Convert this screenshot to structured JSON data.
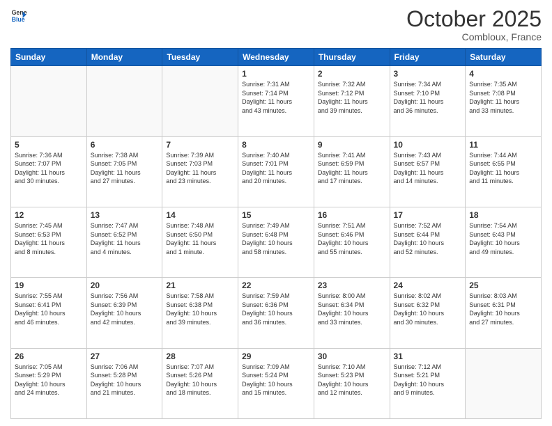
{
  "header": {
    "logo_line1": "General",
    "logo_line2": "Blue",
    "month": "October 2025",
    "location": "Combloux, France"
  },
  "days_of_week": [
    "Sunday",
    "Monday",
    "Tuesday",
    "Wednesday",
    "Thursday",
    "Friday",
    "Saturday"
  ],
  "weeks": [
    [
      {
        "day": "",
        "info": ""
      },
      {
        "day": "",
        "info": ""
      },
      {
        "day": "",
        "info": ""
      },
      {
        "day": "1",
        "info": "Sunrise: 7:31 AM\nSunset: 7:14 PM\nDaylight: 11 hours\nand 43 minutes."
      },
      {
        "day": "2",
        "info": "Sunrise: 7:32 AM\nSunset: 7:12 PM\nDaylight: 11 hours\nand 39 minutes."
      },
      {
        "day": "3",
        "info": "Sunrise: 7:34 AM\nSunset: 7:10 PM\nDaylight: 11 hours\nand 36 minutes."
      },
      {
        "day": "4",
        "info": "Sunrise: 7:35 AM\nSunset: 7:08 PM\nDaylight: 11 hours\nand 33 minutes."
      }
    ],
    [
      {
        "day": "5",
        "info": "Sunrise: 7:36 AM\nSunset: 7:07 PM\nDaylight: 11 hours\nand 30 minutes."
      },
      {
        "day": "6",
        "info": "Sunrise: 7:38 AM\nSunset: 7:05 PM\nDaylight: 11 hours\nand 27 minutes."
      },
      {
        "day": "7",
        "info": "Sunrise: 7:39 AM\nSunset: 7:03 PM\nDaylight: 11 hours\nand 23 minutes."
      },
      {
        "day": "8",
        "info": "Sunrise: 7:40 AM\nSunset: 7:01 PM\nDaylight: 11 hours\nand 20 minutes."
      },
      {
        "day": "9",
        "info": "Sunrise: 7:41 AM\nSunset: 6:59 PM\nDaylight: 11 hours\nand 17 minutes."
      },
      {
        "day": "10",
        "info": "Sunrise: 7:43 AM\nSunset: 6:57 PM\nDaylight: 11 hours\nand 14 minutes."
      },
      {
        "day": "11",
        "info": "Sunrise: 7:44 AM\nSunset: 6:55 PM\nDaylight: 11 hours\nand 11 minutes."
      }
    ],
    [
      {
        "day": "12",
        "info": "Sunrise: 7:45 AM\nSunset: 6:53 PM\nDaylight: 11 hours\nand 8 minutes."
      },
      {
        "day": "13",
        "info": "Sunrise: 7:47 AM\nSunset: 6:52 PM\nDaylight: 11 hours\nand 4 minutes."
      },
      {
        "day": "14",
        "info": "Sunrise: 7:48 AM\nSunset: 6:50 PM\nDaylight: 11 hours\nand 1 minute."
      },
      {
        "day": "15",
        "info": "Sunrise: 7:49 AM\nSunset: 6:48 PM\nDaylight: 10 hours\nand 58 minutes."
      },
      {
        "day": "16",
        "info": "Sunrise: 7:51 AM\nSunset: 6:46 PM\nDaylight: 10 hours\nand 55 minutes."
      },
      {
        "day": "17",
        "info": "Sunrise: 7:52 AM\nSunset: 6:44 PM\nDaylight: 10 hours\nand 52 minutes."
      },
      {
        "day": "18",
        "info": "Sunrise: 7:54 AM\nSunset: 6:43 PM\nDaylight: 10 hours\nand 49 minutes."
      }
    ],
    [
      {
        "day": "19",
        "info": "Sunrise: 7:55 AM\nSunset: 6:41 PM\nDaylight: 10 hours\nand 46 minutes."
      },
      {
        "day": "20",
        "info": "Sunrise: 7:56 AM\nSunset: 6:39 PM\nDaylight: 10 hours\nand 42 minutes."
      },
      {
        "day": "21",
        "info": "Sunrise: 7:58 AM\nSunset: 6:38 PM\nDaylight: 10 hours\nand 39 minutes."
      },
      {
        "day": "22",
        "info": "Sunrise: 7:59 AM\nSunset: 6:36 PM\nDaylight: 10 hours\nand 36 minutes."
      },
      {
        "day": "23",
        "info": "Sunrise: 8:00 AM\nSunset: 6:34 PM\nDaylight: 10 hours\nand 33 minutes."
      },
      {
        "day": "24",
        "info": "Sunrise: 8:02 AM\nSunset: 6:32 PM\nDaylight: 10 hours\nand 30 minutes."
      },
      {
        "day": "25",
        "info": "Sunrise: 8:03 AM\nSunset: 6:31 PM\nDaylight: 10 hours\nand 27 minutes."
      }
    ],
    [
      {
        "day": "26",
        "info": "Sunrise: 7:05 AM\nSunset: 5:29 PM\nDaylight: 10 hours\nand 24 minutes."
      },
      {
        "day": "27",
        "info": "Sunrise: 7:06 AM\nSunset: 5:28 PM\nDaylight: 10 hours\nand 21 minutes."
      },
      {
        "day": "28",
        "info": "Sunrise: 7:07 AM\nSunset: 5:26 PM\nDaylight: 10 hours\nand 18 minutes."
      },
      {
        "day": "29",
        "info": "Sunrise: 7:09 AM\nSunset: 5:24 PM\nDaylight: 10 hours\nand 15 minutes."
      },
      {
        "day": "30",
        "info": "Sunrise: 7:10 AM\nSunset: 5:23 PM\nDaylight: 10 hours\nand 12 minutes."
      },
      {
        "day": "31",
        "info": "Sunrise: 7:12 AM\nSunset: 5:21 PM\nDaylight: 10 hours\nand 9 minutes."
      },
      {
        "day": "",
        "info": ""
      }
    ]
  ]
}
